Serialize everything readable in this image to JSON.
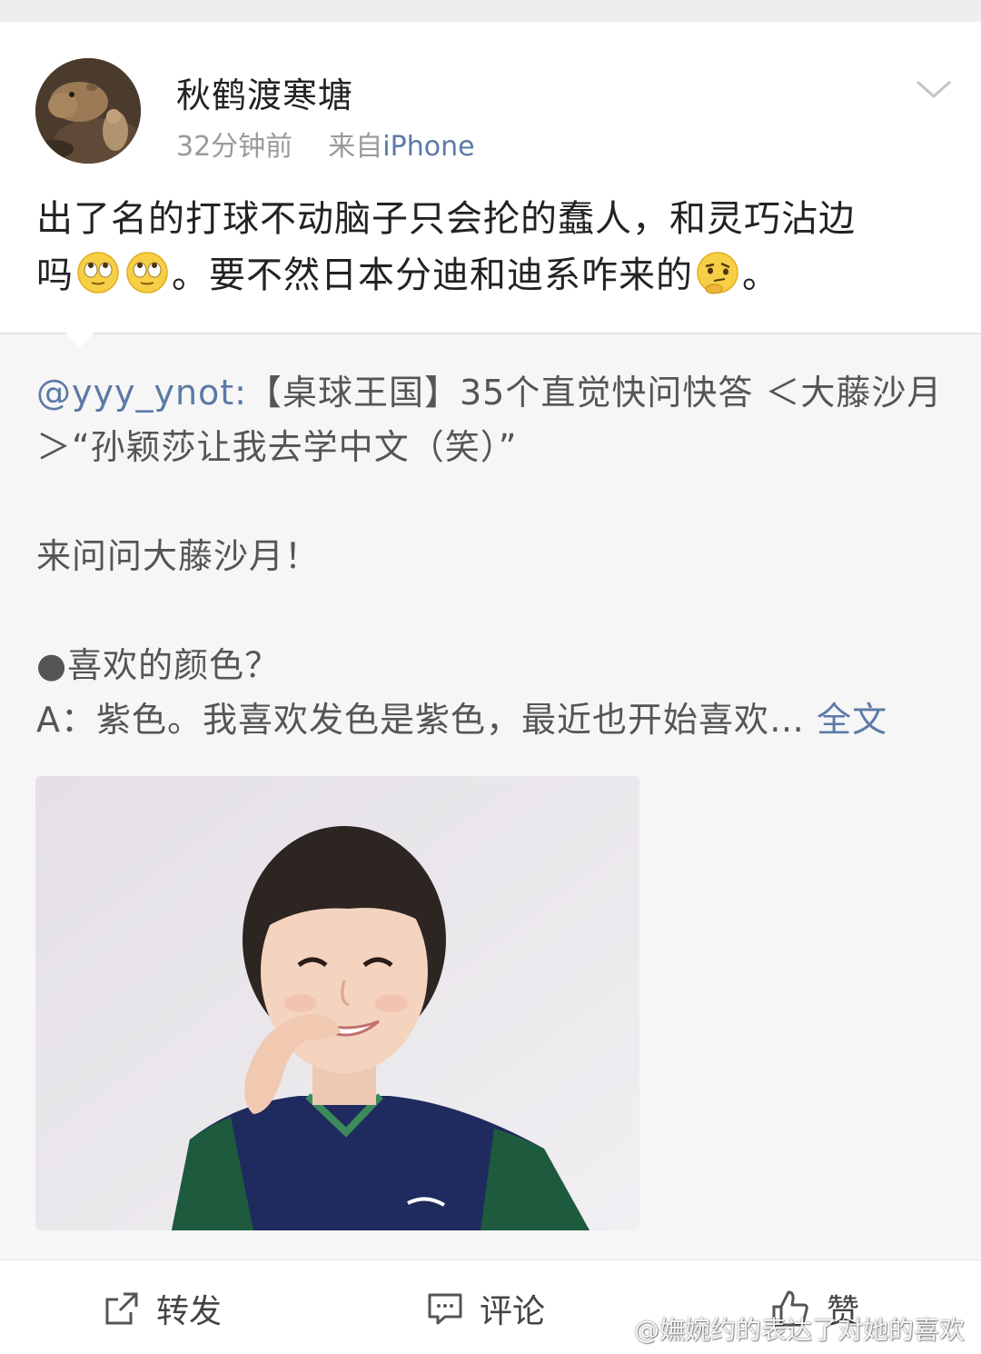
{
  "post": {
    "username": "秋鹤渡寒塘",
    "time": "32分钟前",
    "source_prefix": "来自",
    "source_name": "iPhone",
    "text_line1": "出了名的打球不动脑子只会抡的蠢人，和灵巧沾边",
    "text_line2_a": "吗",
    "text_line2_b": "。要不然日本分迪和迪系咋来的",
    "text_line2_c": "。"
  },
  "repost": {
    "mention": "@yyy_ynot:",
    "line1": "【桌球王国】35个直觉快问快答 ＜大藤沙月",
    "line2": "＞“孙颖莎让我去学中文（笑）”",
    "line3": "来问问大藤沙月！",
    "line4": "●喜欢的颜色？",
    "line5": "A：紫色。我喜欢发色是紫色，最近也开始喜欢…",
    "full_text_link": "全文"
  },
  "actions": {
    "repost": "转发",
    "comment": "评论",
    "like": "赞"
  },
  "watermark": "@嫵婉约的表达了对她的喜欢",
  "colors": {
    "link": "#5b7aa6",
    "card_bg": "#ffffff",
    "repost_bg": "#f6f6f6"
  }
}
